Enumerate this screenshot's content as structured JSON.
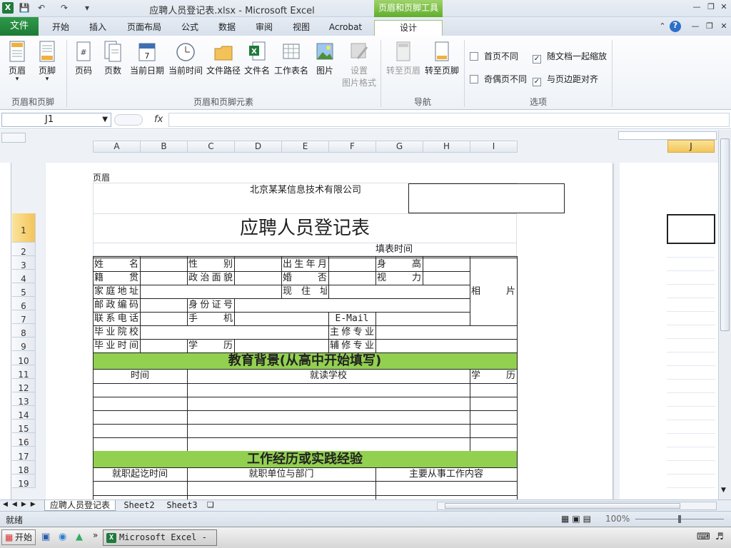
{
  "title": "应聘人员登记表.xlsx - Microsoft Excel",
  "context_tool_title": "页眉和页脚工具",
  "tabs": {
    "file": "文件",
    "home": "开始",
    "insert": "插入",
    "page_layout": "页面布局",
    "formulas": "公式",
    "data": "数据",
    "review": "审阅",
    "view": "视图",
    "acrobat": "Acrobat",
    "design": "设计"
  },
  "ribbon": {
    "header": "页眉",
    "footer": "页脚",
    "page_number": "页码",
    "page_count": "页数",
    "current_date": "当前日期",
    "current_time": "当前时间",
    "file_path": "文件路径",
    "file_name": "文件名",
    "sheet_name": "工作表名",
    "picture": "图片",
    "format_picture_1": "设置",
    "format_picture_2": "图片格式",
    "goto_header": "转至页眉",
    "goto_footer": "转至页脚",
    "group_hf": "页眉和页脚",
    "group_elements": "页眉和页脚元素",
    "group_nav": "导航",
    "group_options": "选项",
    "opt_diff_first": "首页不同",
    "opt_diff_oddeven": "奇偶页不同",
    "opt_scale": "随文档一起缩放",
    "opt_align": "与页边距对齐"
  },
  "namebox": "J1",
  "fx": "fx",
  "columns": [
    "A",
    "B",
    "C",
    "D",
    "E",
    "F",
    "G",
    "H",
    "I"
  ],
  "col_j": "J",
  "rows": [
    "1",
    "2",
    "3",
    "4",
    "5",
    "6",
    "7",
    "8",
    "9",
    "10",
    "11",
    "12",
    "13",
    "14",
    "15",
    "16",
    "17",
    "18",
    "19"
  ],
  "form": {
    "header_label": "页眉",
    "company": "北京某某信息技术有限公司",
    "title": "应聘人员登记表",
    "fill_time": "填表时间",
    "name": "姓　　名",
    "gender": "性　　别",
    "birth": "出生年月",
    "height": "身　　高",
    "origin": "籍　　贯",
    "political": "政治面貌",
    "marital": "婚　　否",
    "vision": "视　　力",
    "home_addr": "家庭地址",
    "current_addr": "现　住　址",
    "photo": "相　　片",
    "postcode": "邮政编码",
    "id_no": "身份证号",
    "phone": "联系电话",
    "mobile": "手　　机",
    "email": "E-Mail",
    "school": "毕业院校",
    "major": "主修专业",
    "grad_time": "毕业时间",
    "degree": "学　　历",
    "minor": "辅修专业",
    "edu_title": "教育背景(从高中开始填写)",
    "edu_time": "时间",
    "edu_school": "就读学校",
    "edu_degree": "学　　历",
    "work_title": "工作经历或实践经验",
    "work_period": "就职起讫时间",
    "work_unit": "就职单位与部门",
    "work_content": "主要从事工作内容"
  },
  "sheets": [
    "应聘人员登记表",
    "Sheet2",
    "Sheet3"
  ],
  "status": {
    "ready": "就绪",
    "zoom": "100%"
  },
  "taskbar": {
    "start": "开始",
    "excel": "Microsoft Excel - ..."
  }
}
